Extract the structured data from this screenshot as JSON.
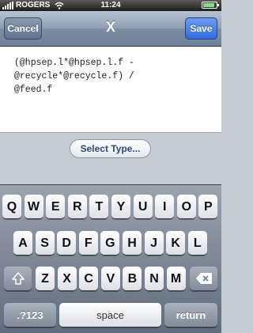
{
  "status_bar": {
    "carrier": "ROGERS",
    "time": "11:24",
    "battery_level": 0.85
  },
  "nav": {
    "cancel_label": "Cancel",
    "title": "X",
    "save_label": "Save"
  },
  "editor": {
    "value": "(@hpsep.l*@hpsep.l.f -\n@recycle*@recycle.f) /\n@feed.f"
  },
  "select_type_label": "Select Type...",
  "keyboard": {
    "row1": [
      "Q",
      "W",
      "E",
      "R",
      "T",
      "Y",
      "U",
      "I",
      "O",
      "P"
    ],
    "row2": [
      "A",
      "S",
      "D",
      "F",
      "G",
      "H",
      "J",
      "K",
      "L"
    ],
    "row3": [
      "Z",
      "X",
      "C",
      "V",
      "B",
      "N",
      "M"
    ],
    "numbers_key": ".?123",
    "space_key": "space",
    "return_key": "return",
    "shift_icon": "shift-arrow-icon",
    "delete_icon": "backspace-icon"
  }
}
